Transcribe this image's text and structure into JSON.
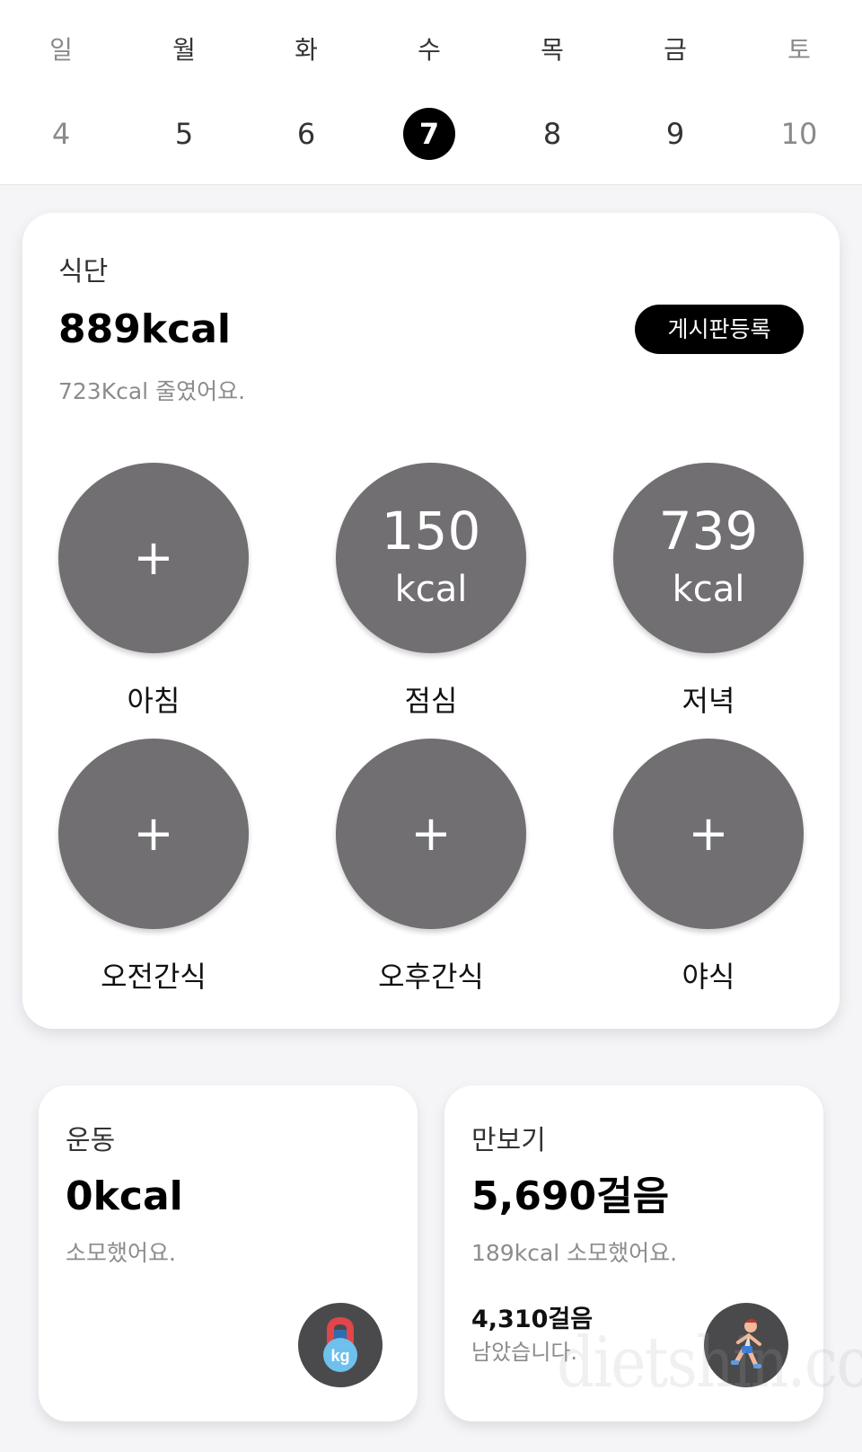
{
  "week": {
    "days": [
      {
        "dow": "일",
        "date": "4",
        "dim": true,
        "selected": false
      },
      {
        "dow": "월",
        "date": "5",
        "dim": false,
        "selected": false
      },
      {
        "dow": "화",
        "date": "6",
        "dim": false,
        "selected": false
      },
      {
        "dow": "수",
        "date": "7",
        "dim": false,
        "selected": true
      },
      {
        "dow": "목",
        "date": "8",
        "dim": false,
        "selected": false
      },
      {
        "dow": "금",
        "date": "9",
        "dim": false,
        "selected": false
      },
      {
        "dow": "토",
        "date": "10",
        "dim": true,
        "selected": false
      }
    ]
  },
  "diet": {
    "title": "식단",
    "total": "889kcal",
    "board_button": "게시판등록",
    "subtitle": "723Kcal 줄였어요.",
    "meals": [
      {
        "label": "아침",
        "empty": true,
        "plus": "+"
      },
      {
        "label": "점심",
        "empty": false,
        "kcal": "150",
        "unit": "kcal"
      },
      {
        "label": "저녁",
        "empty": false,
        "kcal": "739",
        "unit": "kcal"
      },
      {
        "label": "오전간식",
        "empty": true,
        "plus": "+"
      },
      {
        "label": "오후간식",
        "empty": true,
        "plus": "+"
      },
      {
        "label": "야식",
        "empty": true,
        "plus": "+"
      }
    ]
  },
  "exercise": {
    "title": "운동",
    "value": "0kcal",
    "subtitle": "소모했어요.",
    "icon": "kettlebell-icon",
    "icon_text": "kg"
  },
  "pedometer": {
    "title": "만보기",
    "value": "5,690걸음",
    "subtitle": "189kcal 소모했어요.",
    "remaining": "4,310걸음",
    "remaining_text": "남았습니다.",
    "icon": "runner-icon"
  },
  "watermark": "dietshin.com",
  "colors": {
    "meal_circle": "#716f72",
    "accent": "#000000",
    "background": "#f5f5f8"
  }
}
